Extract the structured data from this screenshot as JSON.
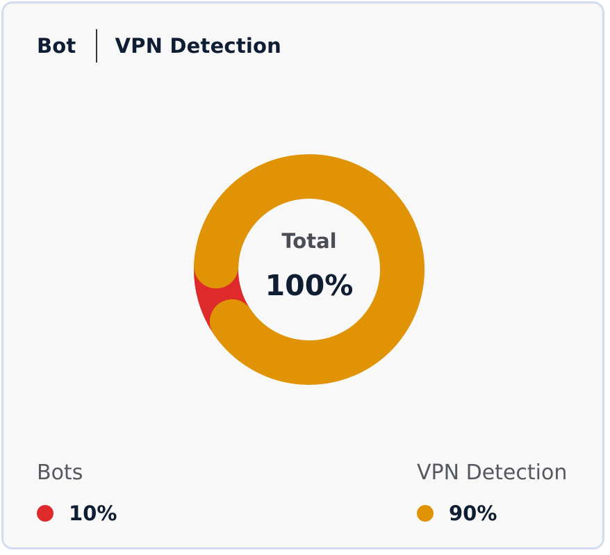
{
  "header": {
    "title_left": "Bot",
    "title_right": "VPN Detection"
  },
  "colors": {
    "bots": "#de2a2a",
    "vpn": "#e09304"
  },
  "chart_data": {
    "type": "pie",
    "variant": "donut",
    "center_label": "Total",
    "center_value": "100%",
    "slices": [
      {
        "name": "Bots",
        "value": 10,
        "display": "10%",
        "color": "#de2a2a"
      },
      {
        "name": "VPN Detection",
        "value": 90,
        "display": "90%",
        "color": "#e09304"
      }
    ],
    "legend_position": "bottom"
  }
}
